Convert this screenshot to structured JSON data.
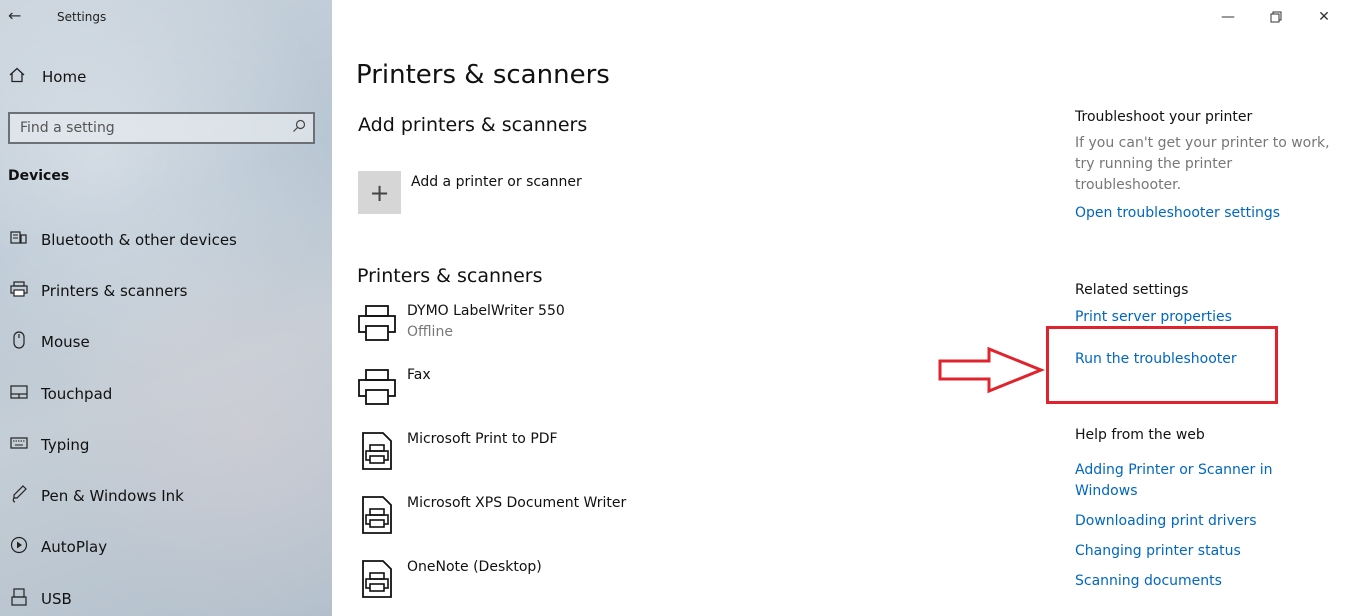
{
  "app": {
    "title": "Settings",
    "back_icon": "back-arrow-icon"
  },
  "window_controls": [
    "minimize-icon",
    "restore-icon",
    "close-icon"
  ],
  "sidebar": {
    "home_label": "Home",
    "search": {
      "placeholder": "Find a setting"
    },
    "section_header": "Devices",
    "items": [
      {
        "label": "Bluetooth & other devices",
        "icon": "bluetooth-devices-icon"
      },
      {
        "label": "Printers & scanners",
        "icon": "printer-icon"
      },
      {
        "label": "Mouse",
        "icon": "mouse-icon"
      },
      {
        "label": "Touchpad",
        "icon": "touchpad-icon"
      },
      {
        "label": "Typing",
        "icon": "keyboard-icon"
      },
      {
        "label": "Pen & Windows Ink",
        "icon": "pen-icon"
      },
      {
        "label": "AutoPlay",
        "icon": "autoplay-icon"
      },
      {
        "label": "USB",
        "icon": "usb-icon"
      }
    ]
  },
  "main": {
    "title": "Printers & scanners",
    "add_section": {
      "header": "Add printers & scanners",
      "add_label": "Add a printer or scanner"
    },
    "printers_section": {
      "header": "Printers & scanners",
      "items": [
        {
          "name": "DYMO LabelWriter 550",
          "status": "Offline",
          "icon": "printer-icon"
        },
        {
          "name": "Fax",
          "status": "",
          "icon": "printer-icon"
        },
        {
          "name": "Microsoft Print to PDF",
          "status": "",
          "icon": "document-printer-icon"
        },
        {
          "name": "Microsoft XPS Document Writer",
          "status": "",
          "icon": "document-printer-icon"
        },
        {
          "name": "OneNote (Desktop)",
          "status": "",
          "icon": "document-printer-icon"
        }
      ]
    }
  },
  "right": {
    "troubleshoot": {
      "header": "Troubleshoot your printer",
      "text": "If you can't get your printer to work, try running the printer troubleshooter.",
      "link": "Open troubleshooter settings"
    },
    "related": {
      "header": "Related settings",
      "links": [
        "Print server properties",
        "Run the troubleshooter"
      ]
    },
    "help": {
      "header": "Help from the web",
      "links": [
        "Adding Printer or Scanner in Windows",
        "Downloading print drivers",
        "Changing printer status",
        "Scanning documents"
      ]
    }
  },
  "colors": {
    "link": "#0067c0",
    "annotation": "#e0242d"
  }
}
